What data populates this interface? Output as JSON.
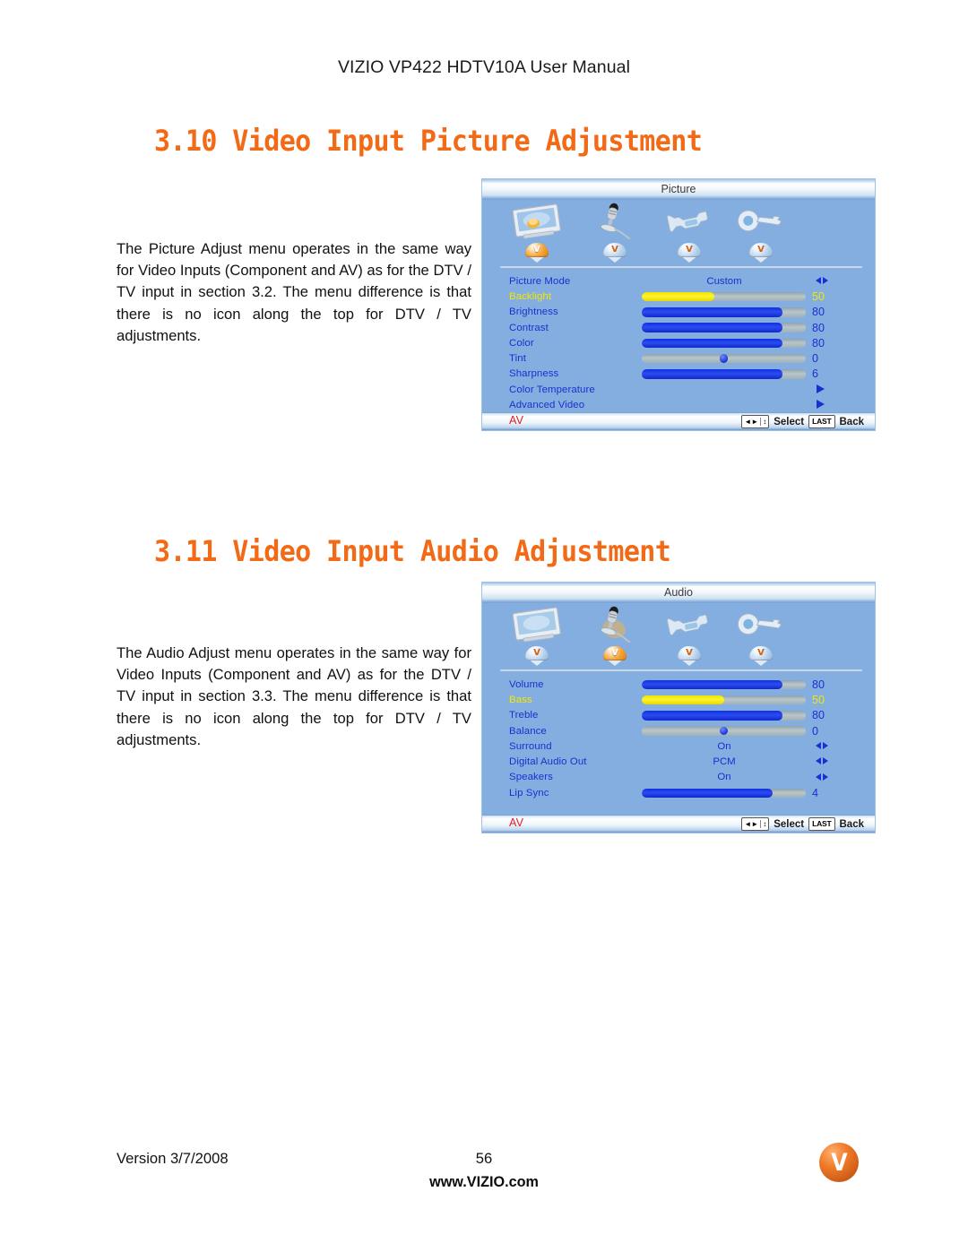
{
  "page": {
    "header_title": "VIZIO VP422 HDTV10A User Manual",
    "version": "Version 3/7/2008",
    "page_number": "56",
    "website": "www.VIZIO.com",
    "logo_letter": "V",
    "accent_color": "#f26a16"
  },
  "sections": [
    {
      "heading": "3.10 Video Input Picture Adjustment",
      "body": "The Picture Adjust menu operates in the same way for Video Inputs (Component and AV) as for the DTV / TV input in section 3.2.  The menu difference is that there is no icon along the top for DTV / TV adjustments."
    },
    {
      "heading": "3.11 Video Input Audio Adjustment",
      "body": "The Audio Adjust menu operates in the same way for Video Inputs (Component and AV) as for the DTV / TV input in section 3.3.  The menu difference is that there is no icon along the top for DTV / TV adjustments."
    }
  ],
  "osd_picture": {
    "title": "Picture",
    "icons": [
      {
        "name": "picture-tv-icon",
        "active": true
      },
      {
        "name": "audio-microphone-icon",
        "active": false
      },
      {
        "name": "setup-wrench-icon",
        "active": false
      },
      {
        "name": "parental-key-icon",
        "active": false
      }
    ],
    "badge_letter": "V",
    "rows": [
      {
        "label": "Picture Mode",
        "type": "option",
        "value": "Custom",
        "arrows": "lr"
      },
      {
        "label": "Backlight",
        "type": "slider",
        "number": "50",
        "percent": 44,
        "selected": true
      },
      {
        "label": "Brightness",
        "type": "slider",
        "number": "80",
        "percent": 86
      },
      {
        "label": "Contrast",
        "type": "slider",
        "number": "80",
        "percent": 86
      },
      {
        "label": "Color",
        "type": "slider",
        "number": "80",
        "percent": 86
      },
      {
        "label": "Tint",
        "type": "slider-knob",
        "number": "0",
        "percent": 50
      },
      {
        "label": "Sharpness",
        "type": "slider",
        "number": "6",
        "percent": 86
      },
      {
        "label": "Color Temperature",
        "type": "submenu",
        "arrows": "right-only"
      },
      {
        "label": "Advanced Video",
        "type": "submenu",
        "arrows": "right-only"
      }
    ],
    "footer": {
      "input_label": "AV",
      "nav_left_right": "◄►",
      "nav_up_down": "↕",
      "select_label": "Select",
      "last_key_label": "LAST",
      "back_label": "Back"
    }
  },
  "osd_audio": {
    "title": "Audio",
    "icons": [
      {
        "name": "picture-tv-icon",
        "active": false
      },
      {
        "name": "audio-microphone-icon",
        "active": true
      },
      {
        "name": "setup-wrench-icon",
        "active": false
      },
      {
        "name": "parental-key-icon",
        "active": false
      }
    ],
    "badge_letter": "V",
    "rows": [
      {
        "label": "Volume",
        "type": "slider",
        "number": "80",
        "percent": 86
      },
      {
        "label": "Bass",
        "type": "slider",
        "number": "50",
        "percent": 50,
        "selected": true
      },
      {
        "label": "Treble",
        "type": "slider",
        "number": "80",
        "percent": 86
      },
      {
        "label": "Balance",
        "type": "slider-knob",
        "number": "0",
        "percent": 50
      },
      {
        "label": "Surround",
        "type": "option",
        "value": "On",
        "arrows": "lr"
      },
      {
        "label": "Digital Audio Out",
        "type": "option",
        "value": "PCM",
        "arrows": "lr"
      },
      {
        "label": "Speakers",
        "type": "option",
        "value": "On",
        "arrows": "lr"
      },
      {
        "label": "Lip Sync",
        "type": "slider",
        "number": "4",
        "percent": 80
      }
    ],
    "footer": {
      "input_label": "AV",
      "nav_left_right": "◄►",
      "nav_up_down": "↕",
      "select_label": "Select",
      "last_key_label": "LAST",
      "back_label": "Back"
    }
  }
}
